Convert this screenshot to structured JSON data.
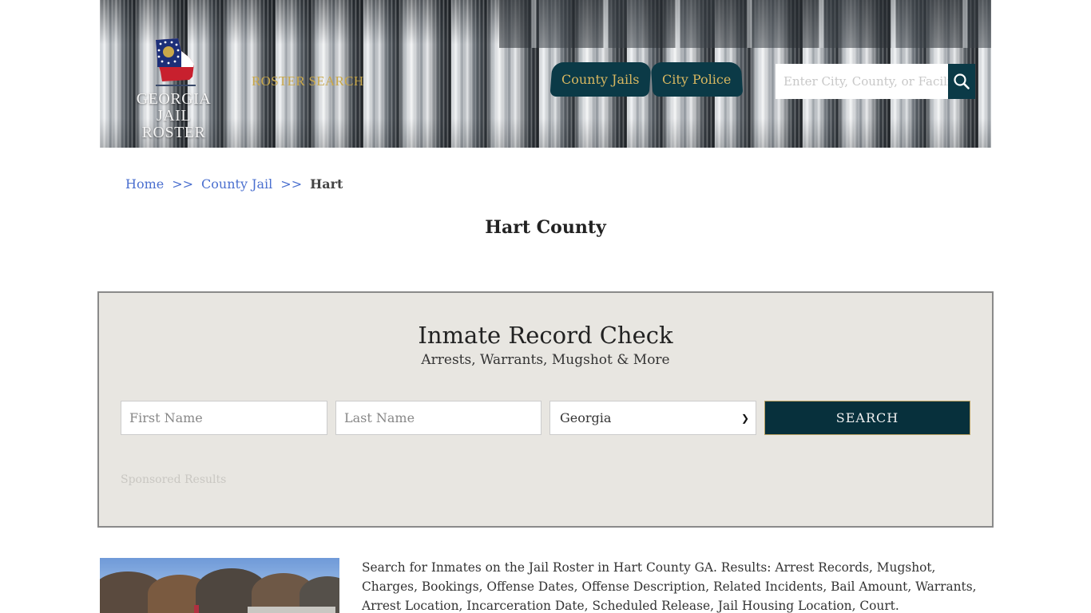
{
  "header": {
    "logo_line1": "GEORGIA",
    "logo_line2": "JAIL ROSTER",
    "roster_search_label": "ROSTER SEARCH",
    "nav": [
      {
        "label": "County Jails"
      },
      {
        "label": "City Police"
      }
    ],
    "search": {
      "placeholder": "Enter City, County, or Facility",
      "icon": "search-icon"
    }
  },
  "breadcrumb": {
    "items": [
      {
        "label": "Home"
      },
      {
        "label": "County Jail"
      }
    ],
    "separator": ">>",
    "current": "Hart"
  },
  "page_title": "Hart County",
  "record_check": {
    "title": "Inmate Record Check",
    "subtitle": "Arrests, Warrants, Mugshot & More",
    "first_name_placeholder": "First Name",
    "last_name_placeholder": "Last Name",
    "state_selected": "Georgia",
    "search_button": "SEARCH",
    "sponsored_label": "Sponsored Results"
  },
  "description": "Search for Inmates on the Jail Roster in Hart County GA. Results: Arrest Records, Mugshot, Charges, Bookings, Offense Dates, Offense Description, Related Incidents, Bail Amount, Warrants, Arrest Location, Incarceration Date, Scheduled Release, Jail Housing Location, Court.",
  "colors": {
    "brand_dark": "#0b3a47",
    "gold": "#d8b760",
    "link": "#4a6fcf",
    "panel_bg": "#e8e6e1"
  }
}
